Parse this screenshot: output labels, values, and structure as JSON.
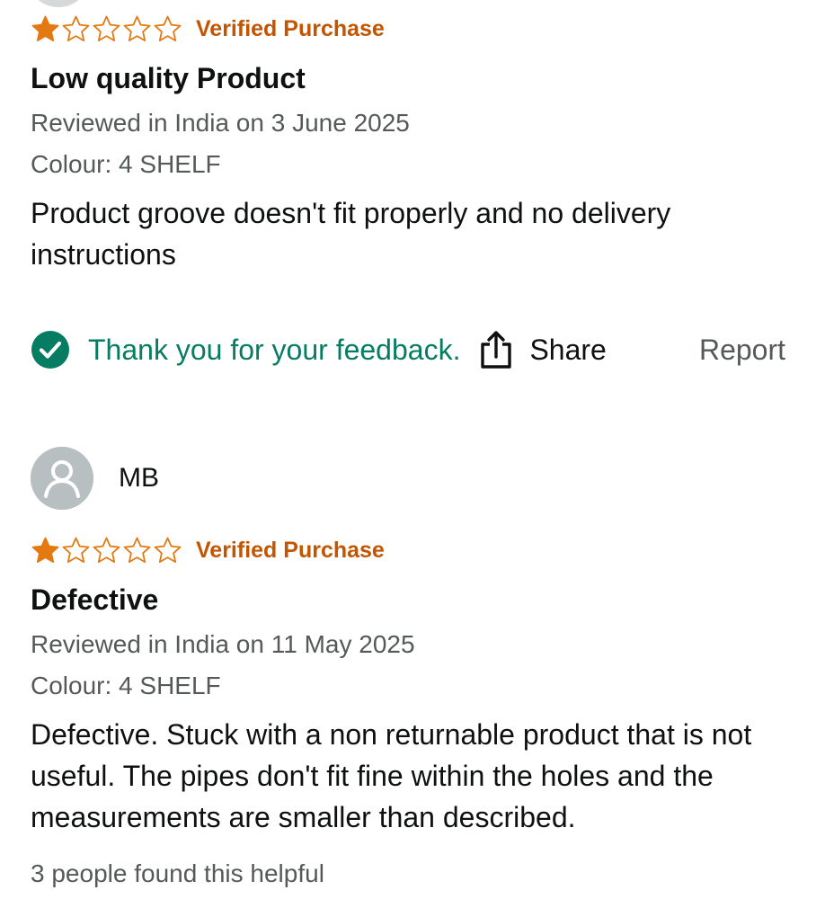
{
  "reviews": [
    {
      "rating": 1,
      "rating_max": 5,
      "verified_label": "Verified Purchase",
      "title": "Low quality Product",
      "reviewed_in": "Reviewed in India on 3 June 2025",
      "colour": "Colour: 4 SHELF",
      "body": "Product groove doesn't fit properly and no delivery instructions",
      "feedback_text": "Thank you for your feedback.",
      "share_label": "Share",
      "report_label": "Report"
    },
    {
      "reviewer_name": "MB",
      "rating": 1,
      "rating_max": 5,
      "verified_label": "Verified Purchase",
      "title": "Defective",
      "reviewed_in": "Reviewed in India on 11 May 2025",
      "colour": "Colour: 4 SHELF",
      "body": "Defective. Stuck with a non returnable product that is not useful. The pipes don't fit fine within the holes and the measurements are smaller than described.",
      "helpful_text": "3 people found this helpful"
    }
  ],
  "icons": {
    "star_filled": "star-filled-icon",
    "star_empty": "star-empty-icon",
    "check": "check-circle-icon",
    "share": "share-icon",
    "avatar": "user-avatar-icon"
  },
  "colors": {
    "star": "#e47911",
    "verified": "#c45500",
    "feedback": "#067d62",
    "muted": "#565959",
    "text": "#0f1111"
  }
}
